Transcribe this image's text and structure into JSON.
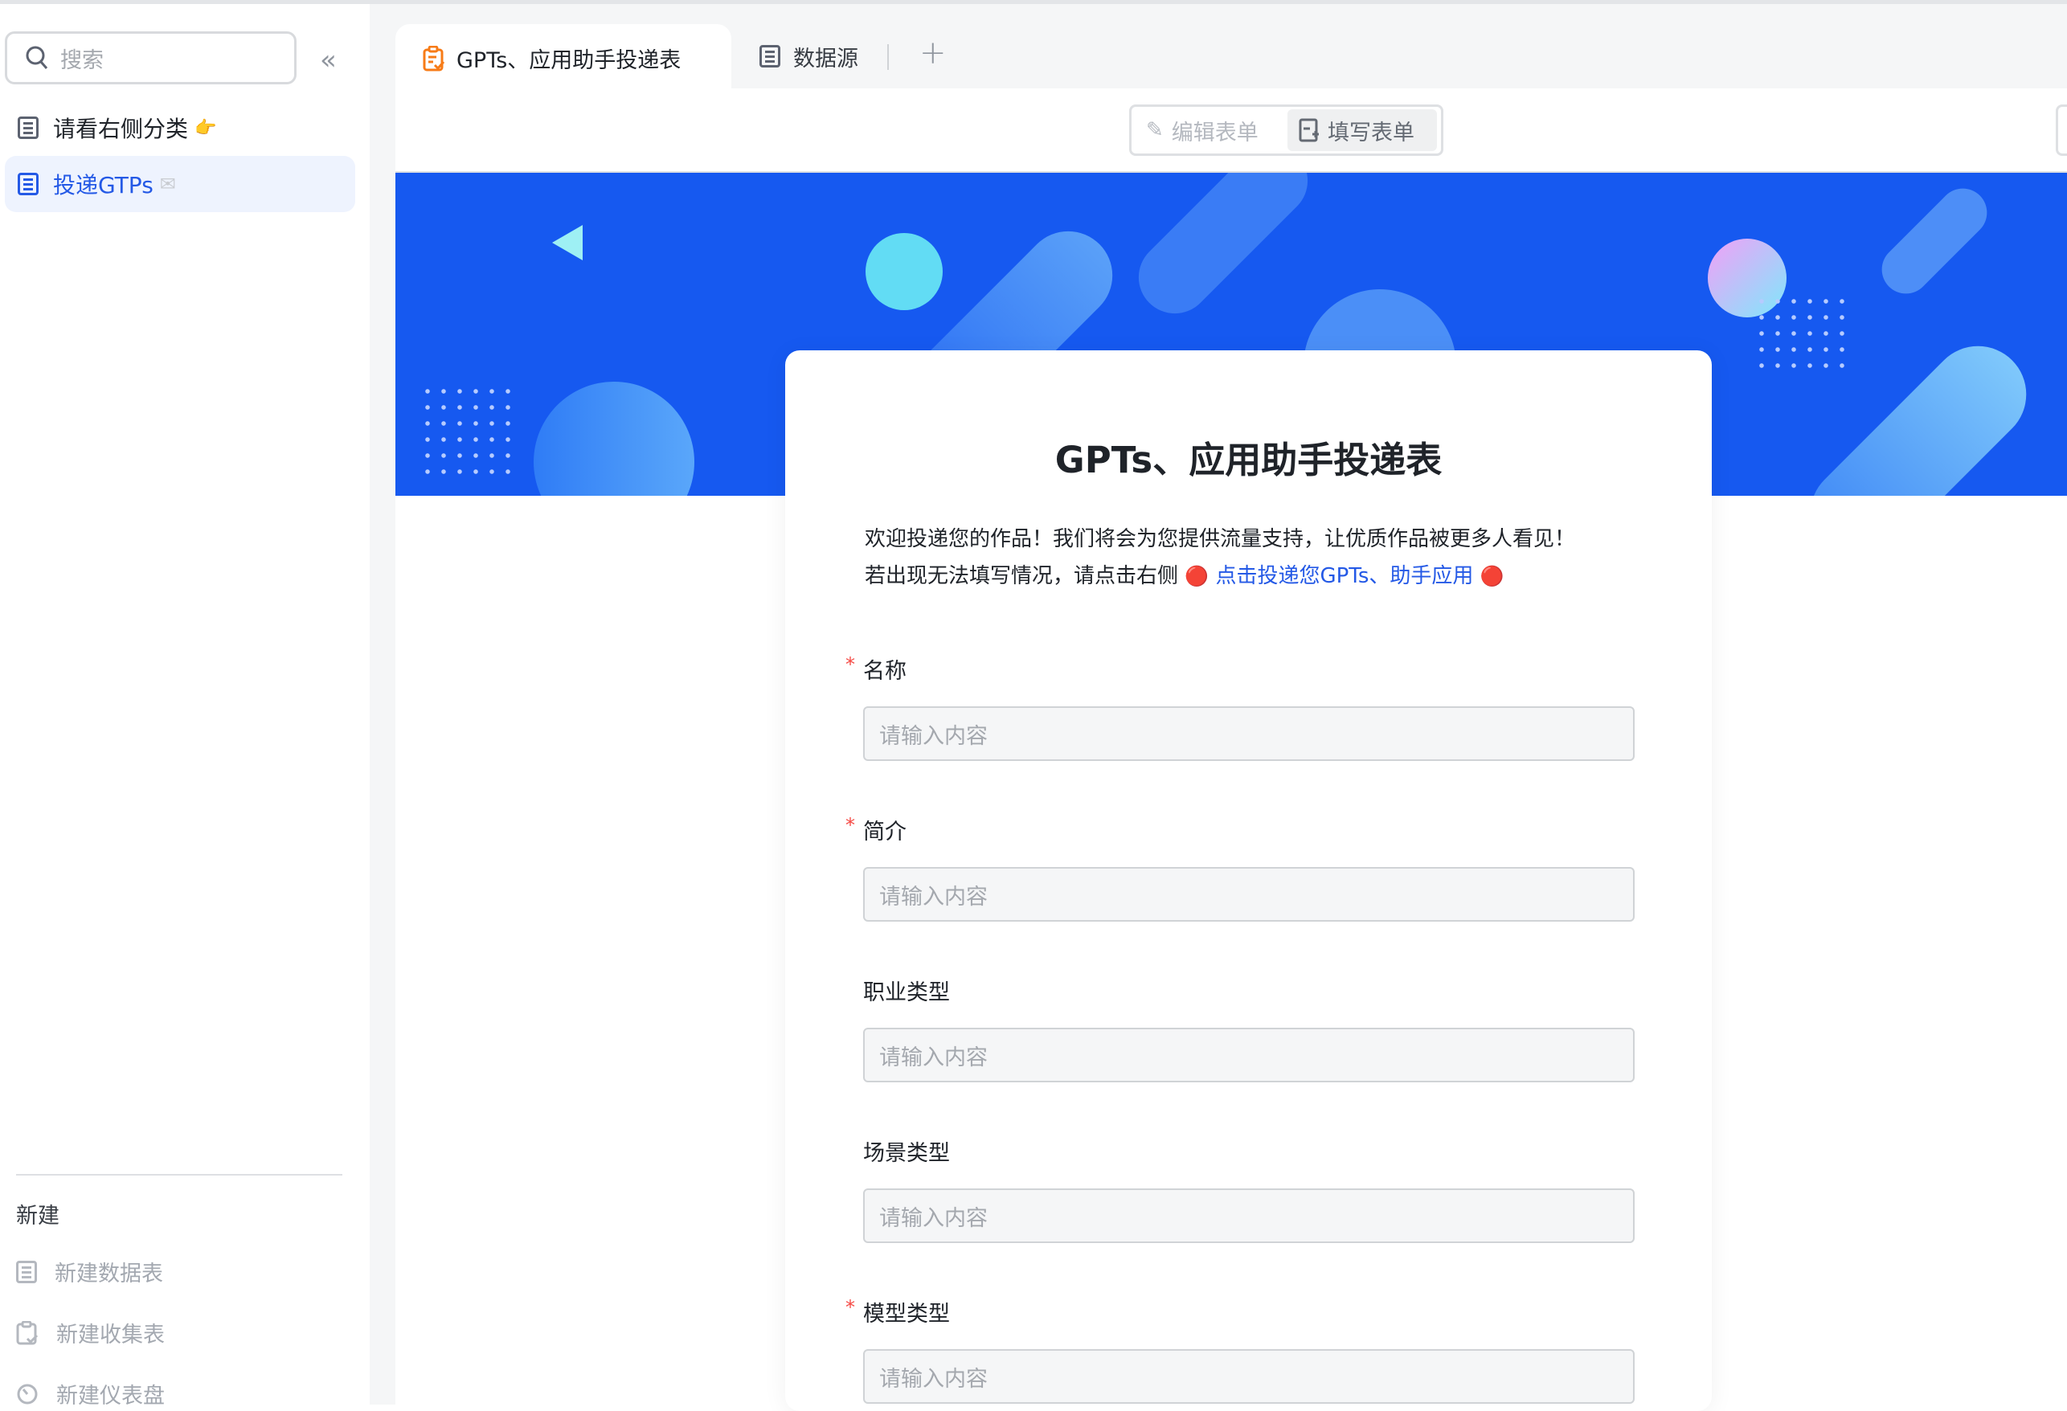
{
  "sidebar": {
    "search_placeholder": "搜索",
    "items": [
      {
        "label": "请看右侧分类",
        "emoji": "👉",
        "active": false
      },
      {
        "label": "投递GTPs",
        "emoji": "✉",
        "active": true
      }
    ],
    "new_section": {
      "header": "新建",
      "items": [
        {
          "label": "新建数据表",
          "icon": "table-icon"
        },
        {
          "label": "新建收集表",
          "icon": "form-icon"
        },
        {
          "label": "新建仪表盘",
          "icon": "dashboard-icon"
        }
      ]
    }
  },
  "tabs": [
    {
      "label": "GPTs、应用助手投递表",
      "icon": "form-icon",
      "active": true
    },
    {
      "label": "数据源",
      "icon": "table-icon",
      "active": false
    }
  ],
  "toolbar": {
    "edit_label": "编辑表单",
    "fill_label": "填写表单",
    "active": "fill"
  },
  "form": {
    "title": "GPTs、应用助手投递表",
    "desc_line1": "欢迎投递您的作品！我们将会为您提供流量支持，让优质作品被更多人看见！",
    "desc_line2_prefix": "若出现无法填写情况，请点击右侧",
    "desc_link": "点击投递您GPTs、助手应用",
    "marker": "🔴",
    "fields": [
      {
        "label": "名称",
        "required": true,
        "placeholder": "请输入内容"
      },
      {
        "label": "简介",
        "required": true,
        "placeholder": "请输入内容"
      },
      {
        "label": "职业类型",
        "required": false,
        "placeholder": "请输入内容"
      },
      {
        "label": "场景类型",
        "required": false,
        "placeholder": "请输入内容"
      },
      {
        "label": "模型类型",
        "required": true,
        "placeholder": "请输入内容"
      }
    ],
    "required_mark": "*"
  },
  "colors": {
    "accent": "#2459e6",
    "banner": "#1659f0",
    "required": "#f54a45",
    "form_tab_icon": "#f77b17"
  }
}
